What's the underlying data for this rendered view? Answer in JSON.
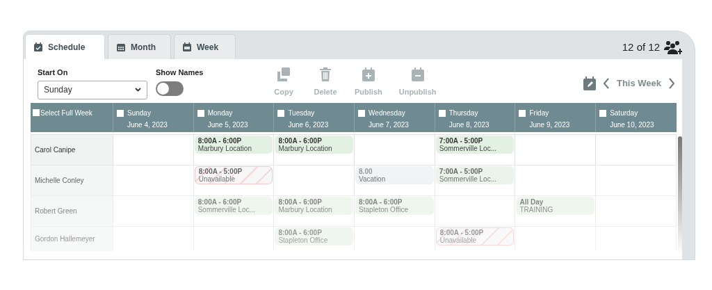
{
  "tabs": [
    {
      "label": "Schedule",
      "selected": true
    },
    {
      "label": "Month",
      "selected": false
    },
    {
      "label": "Week",
      "selected": false
    }
  ],
  "count": "12 of 12",
  "start_on": {
    "label": "Start On",
    "value": "Sunday"
  },
  "show_names": {
    "label": "Show Names",
    "on": false
  },
  "actions": [
    {
      "label": "Copy",
      "kind": "copy"
    },
    {
      "label": "Delete",
      "kind": "delete"
    },
    {
      "label": "Publish",
      "kind": "publish"
    },
    {
      "label": "Unpublish",
      "kind": "unpublish"
    }
  ],
  "week_nav": {
    "label": "This Week"
  },
  "select_all": {
    "label": "Select Full Week",
    "checked": false
  },
  "days": [
    {
      "name": "Sunday",
      "date": "June 4, 2023",
      "checked": false
    },
    {
      "name": "Monday",
      "date": "June 5, 2023",
      "checked": false
    },
    {
      "name": "Tuesday",
      "date": "June 6, 2023",
      "checked": false
    },
    {
      "name": "Wednesday",
      "date": "June 7, 2023",
      "checked": false
    },
    {
      "name": "Thursday",
      "date": "June 8, 2023",
      "checked": false
    },
    {
      "name": "Friday",
      "date": "June 9, 2023",
      "checked": false
    },
    {
      "name": "Saturday",
      "date": "June 10, 2023",
      "checked": false
    }
  ],
  "rows": [
    {
      "name": "Carol Canipe",
      "cells": [
        null,
        {
          "kind": "shift",
          "time": "8:00A - 6:00P",
          "place": "Marbury Location"
        },
        {
          "kind": "shift",
          "time": "8:00A - 6:00P",
          "place": "Marbury Location"
        },
        null,
        {
          "kind": "shift",
          "time": "7:00A - 5:00P",
          "place": "Sommerville Loc..."
        },
        null,
        null
      ]
    },
    {
      "name": "Michelle Conley",
      "cells": [
        null,
        {
          "kind": "unavailable",
          "time": "8:00A - 5:00P",
          "place": "Unavailable"
        },
        null,
        {
          "kind": "timeoff",
          "time": "8.00",
          "place": "Vacation"
        },
        {
          "kind": "shift",
          "time": "7:00A - 5:00P",
          "place": "Sommerville Loc..."
        },
        null,
        null
      ]
    },
    {
      "name": "Robert Green",
      "cells": [
        null,
        {
          "kind": "shift",
          "time": "8:00A - 6:00P",
          "place": "Sommerville Loc..."
        },
        {
          "kind": "shift",
          "time": "8:00A - 6:00P",
          "place": "Marbury Location"
        },
        {
          "kind": "shift",
          "time": "8:00A - 6:00P",
          "place": "Stapleton Office"
        },
        null,
        {
          "kind": "shift",
          "time": "All Day",
          "place": "TRAINING"
        },
        null
      ]
    },
    {
      "name": "Gordon Hallemeyer",
      "cells": [
        null,
        null,
        {
          "kind": "shift",
          "time": "8:00A - 6:00P",
          "place": "Stapleton Office"
        },
        null,
        {
          "kind": "unavailable",
          "time": "8:00A - 5:00P",
          "place": "Unavailable"
        },
        null,
        null
      ]
    }
  ]
}
